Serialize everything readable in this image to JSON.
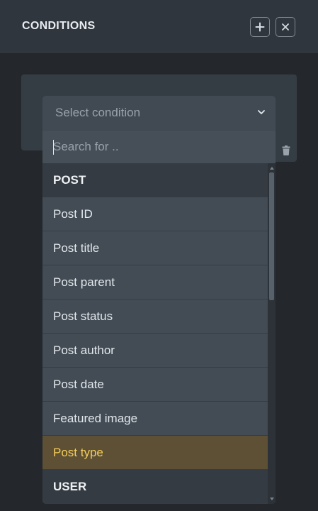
{
  "header": {
    "title": "CONDITIONS",
    "add_icon": "plus-icon",
    "close_icon": "close-icon"
  },
  "condition": {
    "select_placeholder": "Select condition",
    "chevron_icon": "chevron-down-icon",
    "delete_icon": "trash-icon"
  },
  "search": {
    "placeholder": "Search for .."
  },
  "options": [
    {
      "label": "POST",
      "kind": "group"
    },
    {
      "label": "Post ID",
      "kind": "option"
    },
    {
      "label": "Post title",
      "kind": "option"
    },
    {
      "label": "Post parent",
      "kind": "option"
    },
    {
      "label": "Post status",
      "kind": "option"
    },
    {
      "label": "Post author",
      "kind": "option"
    },
    {
      "label": "Post date",
      "kind": "option"
    },
    {
      "label": "Featured image",
      "kind": "option"
    },
    {
      "label": "Post type",
      "kind": "option",
      "highlighted": true
    },
    {
      "label": "USER",
      "kind": "group"
    }
  ],
  "colors": {
    "accent_highlight_text": "#f4cd5a",
    "accent_highlight_bg": "#5e5035",
    "panel_bg": "#24282c"
  }
}
